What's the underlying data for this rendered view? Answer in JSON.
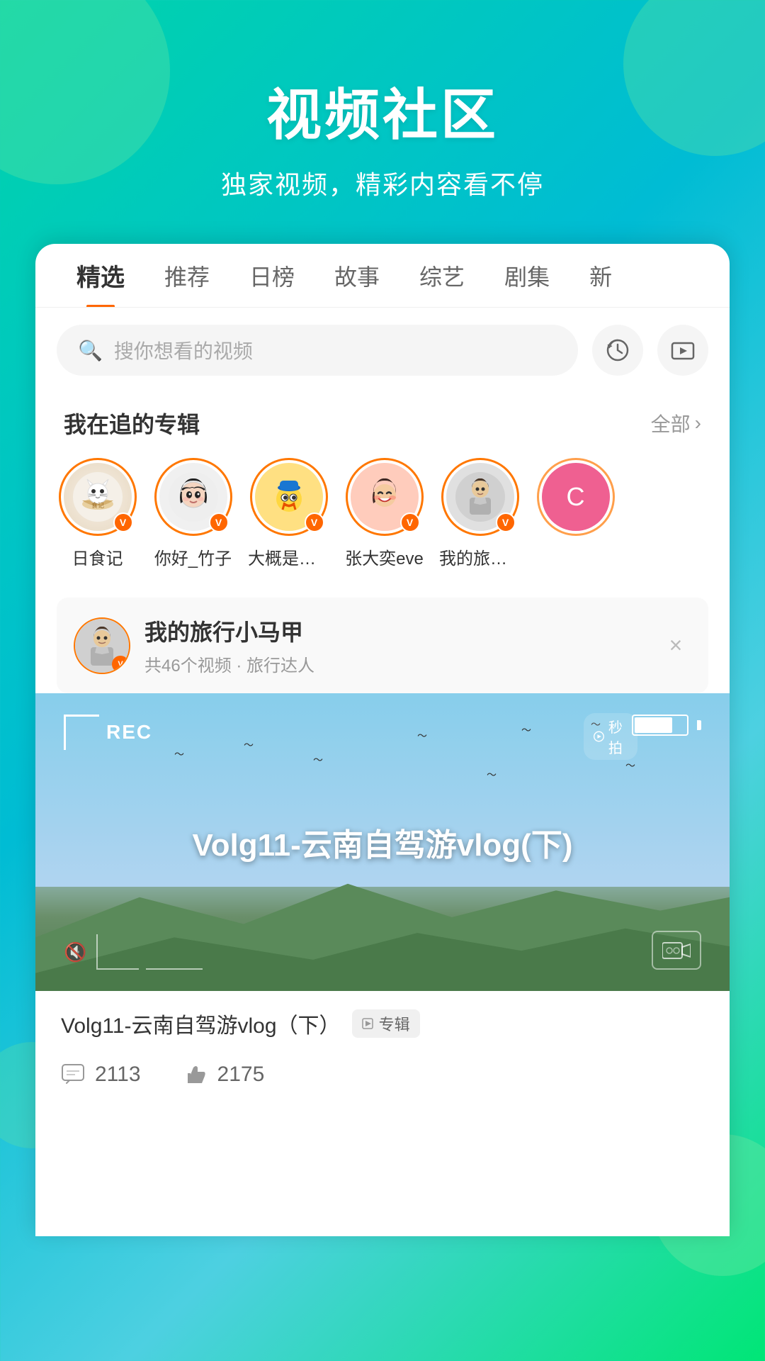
{
  "header": {
    "title": "视频社区",
    "subtitle": "独家视频，精彩内容看不停"
  },
  "tabs": [
    {
      "id": "jingxuan",
      "label": "精选",
      "active": true
    },
    {
      "id": "tuijian",
      "label": "推荐",
      "active": false
    },
    {
      "id": "ribang",
      "label": "日榜",
      "active": false
    },
    {
      "id": "gushi",
      "label": "故事",
      "active": false
    },
    {
      "id": "zongyi",
      "label": "综艺",
      "active": false
    },
    {
      "id": "juji",
      "label": "剧集",
      "active": false
    },
    {
      "id": "xin",
      "label": "新",
      "active": false
    }
  ],
  "search": {
    "placeholder": "搜你想看的视频"
  },
  "following_section": {
    "title": "我在追的专辑",
    "more_label": "全部",
    "albums": [
      {
        "id": "risshoku",
        "name": "日食记",
        "emoji": "🍱",
        "bg": "#f5f0e8"
      },
      {
        "id": "nihao",
        "name": "你好_竹子",
        "emoji": "📖",
        "bg": "#f0f0f0"
      },
      {
        "id": "jiing",
        "name": "大概是井越",
        "emoji": "🐱",
        "bg": "#ffe082"
      },
      {
        "id": "zhang",
        "name": "张大奕eve",
        "emoji": "😊",
        "bg": "#ffccbc"
      },
      {
        "id": "travel",
        "name": "我的旅行...",
        "emoji": "🧥",
        "bg": "#e0e0e0"
      },
      {
        "id": "partial",
        "name": "C",
        "emoji": "C",
        "bg": "#e91e63"
      }
    ]
  },
  "info_card": {
    "title": "我的旅行小马甲",
    "meta": "共46个视频 · 旅行达人",
    "avatar_emoji": "🧥",
    "avatar_bg": "#e0e0e0"
  },
  "video": {
    "rec_text": "REC",
    "title_overlay": "Volg11-云南自驾游vlog(下)",
    "info_title": "Volg11-云南自驾游vlog（下）",
    "album_label": "专辑",
    "comments_count": "2113",
    "likes_count": "2175"
  },
  "icons": {
    "search": "🔍",
    "history": "⏱",
    "video_folder": "📁",
    "more_arrow": "›",
    "vip_v": "V",
    "comment": "💬",
    "like": "👍",
    "play": "▶",
    "mute": "🔇",
    "seconds": "⏱",
    "close": "×"
  }
}
